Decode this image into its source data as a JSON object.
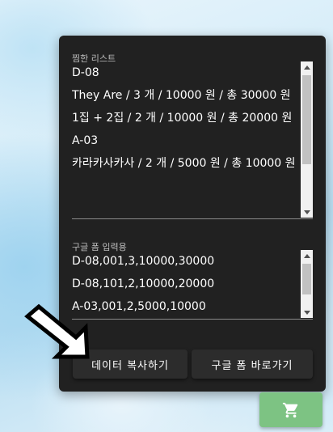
{
  "wishlist": {
    "label": "찜한 리스트",
    "content": "D-08\nThey Are / 3 개 / 10000 원 / 총 30000 원\n1집 + 2집 / 2 개 / 10000 원 / 총 20000 원\nA-03\n카라카사카사 / 2 개 / 5000 원 / 총 10000 원"
  },
  "form_input": {
    "label": "구글 폼 입력용",
    "content": "D-08,001,3,10000,30000\nD-08,101,2,10000,20000\nA-03,001,2,5000,10000"
  },
  "buttons": {
    "copy_label": "데이터 복사하기",
    "form_label": "구글 폼 바로가기"
  },
  "icons": {
    "cart": "shopping-cart-icon",
    "pointer": "arrow-pointer-icon"
  },
  "colors": {
    "panel_bg": "#212121",
    "fab_bg": "#7dc383"
  }
}
